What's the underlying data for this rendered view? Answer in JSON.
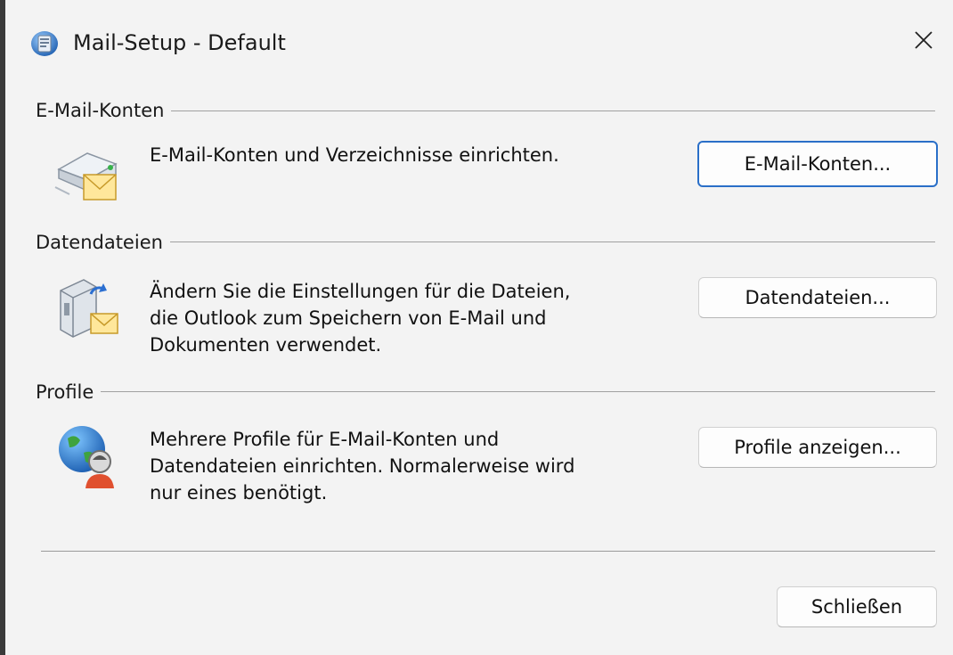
{
  "window": {
    "title": "Mail-Setup - Default"
  },
  "sections": [
    {
      "label": "E-Mail-Konten",
      "description": [
        "E-Mail-Konten und Verzeichnisse einrichten."
      ],
      "button": "E-Mail-Konten..."
    },
    {
      "label": "Datendateien",
      "description": [
        "Ändern Sie die Einstellungen für die Dateien,",
        "die Outlook zum Speichern von E-Mail und",
        "Dokumenten verwendet."
      ],
      "button": "Datendateien..."
    },
    {
      "label": "Profile",
      "description": [
        "Mehrere Profile für E-Mail-Konten und",
        "Datendateien einrichten. Normalerweise wird",
        "nur eines benötigt."
      ],
      "button": "Profile anzeigen..."
    }
  ],
  "footer": {
    "close_button": "Schließen"
  },
  "icons": {
    "app": "mail-setup-icon",
    "close": "close-icon",
    "accounts": "email-accounts-icon",
    "datafiles": "data-files-icon",
    "profiles": "profiles-icon"
  },
  "colors": {
    "default_button_border": "#2a6fc8",
    "background": "#f3f3f3"
  }
}
